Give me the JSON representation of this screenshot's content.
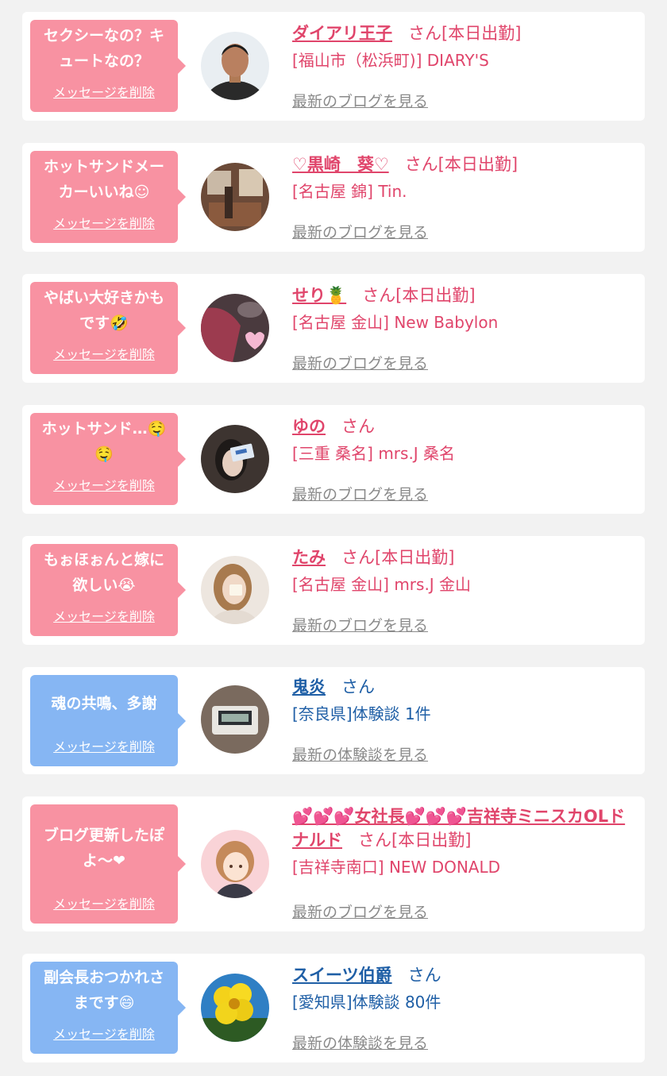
{
  "delete_label": "メッセージを削除",
  "items": [
    {
      "bubble_lines": [
        "セクシーなの？キ",
        "ュートなの？"
      ],
      "name": "ダイアリ王子",
      "suffix": "さん[本日出勤]",
      "shop": "[福山市（松浜町)] DIARY'S",
      "more": "最新のブログを見る",
      "theme": "pink",
      "avatar_icon": "man-portrait-avatar"
    },
    {
      "bubble_lines": [
        "ホットサンドメー",
        "カーいいね☺"
      ],
      "name": "♡黒崎　葵♡",
      "suffix": "さん[本日出勤]",
      "shop": "[名古屋 錦] Tin.",
      "more": "最新のブログを見る",
      "theme": "pink",
      "avatar_icon": "room-interior-avatar"
    },
    {
      "bubble_lines": [
        "やばい大好きかも",
        "です🤣"
      ],
      "name": "せり🍍",
      "suffix": "さん[本日出勤]",
      "shop": "[名古屋 金山] New Babylon",
      "more": "最新のブログを見る",
      "theme": "pink",
      "avatar_icon": "red-hair-heart-avatar"
    },
    {
      "bubble_lines": [
        "ホットサンド…🤤",
        "🤤"
      ],
      "name": "ゆの",
      "suffix": "さん",
      "shop": "[三重 桑名] mrs.J 桑名",
      "more": "最新のブログを見る",
      "theme": "pink",
      "avatar_icon": "woman-card-avatar"
    },
    {
      "bubble_lines": [
        "もぉほぉんと嫁に",
        "欲しい😭"
      ],
      "name": "たみ",
      "suffix": "さん[本日出勤]",
      "shop": "[名古屋 金山] mrs.J 金山",
      "more": "最新のブログを見る",
      "theme": "pink",
      "avatar_icon": "woman-mask-avatar"
    },
    {
      "bubble_lines": [
        "魂の共鳴、多謝"
      ],
      "name": "鬼炎",
      "suffix": "さん",
      "shop": "[奈良県]体験談 1件",
      "more": "最新の体験談を見る",
      "theme": "blue",
      "avatar_icon": "digital-clock-avatar"
    },
    {
      "bubble_lines": [
        "ブログ更新したぽ",
        "よ〜❤"
      ],
      "name": "💕💕💕女社長💕💕💕吉祥寺ミニスカOLドナルド",
      "suffix": "さん[本日出勤]",
      "shop": "[吉祥寺南口] NEW DONALD",
      "more": "最新のブログを見る",
      "theme": "pink",
      "avatar_icon": "anime-girl-avatar"
    },
    {
      "bubble_lines": [
        "副会長おつかれさ",
        "まです😄"
      ],
      "name": "スイーツ伯爵",
      "suffix": "さん",
      "shop": "[愛知県]体験談 80件",
      "more": "最新の体験談を見る",
      "theme": "blue",
      "avatar_icon": "yellow-flower-avatar"
    }
  ]
}
